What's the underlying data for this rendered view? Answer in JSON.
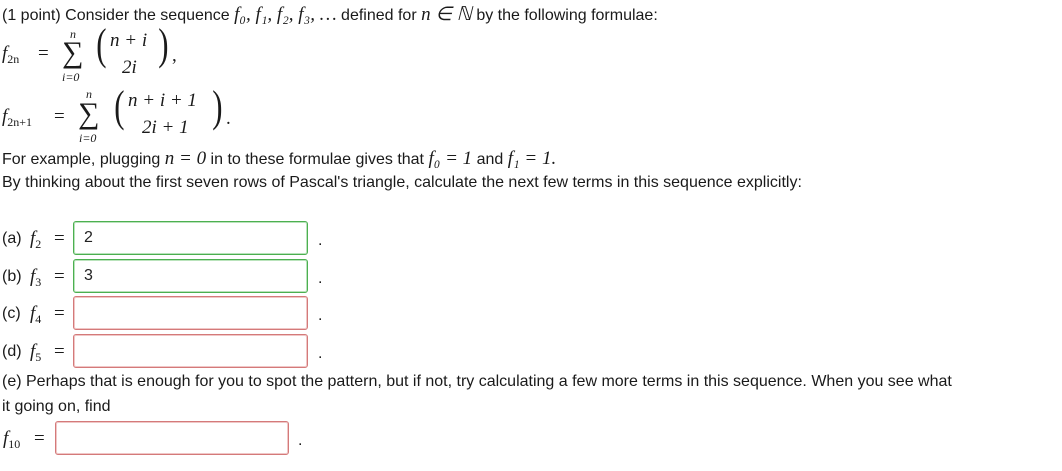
{
  "intro": {
    "points": "(1 point) Consider the sequence",
    "seq": "f₀, f₁, f₂, f₃, …",
    "defined_for": "defined for",
    "n_in_N": "n ∈ ℕ",
    "by_following": "by the following formulae:"
  },
  "formula1": {
    "lhs": "f",
    "lhs_sub": "2n",
    "eq": "=",
    "upper": "n",
    "lower": "i=0",
    "top": "n + i",
    "bottom": "2i",
    "tail": ","
  },
  "formula2": {
    "lhs": "f",
    "lhs_sub": "2n+1",
    "eq": "=",
    "upper": "n",
    "lower": "i=0",
    "top": "n + i + 1",
    "bottom": "2i + 1",
    "tail": "."
  },
  "example": {
    "text1": "For example, plugging",
    "n0": "n = 0",
    "text2": "in to these formulae gives that",
    "f0": "f₀ = 1",
    "and": "and",
    "f1": "f₁ = 1."
  },
  "instruction": "By thinking about the first seven rows of Pascal's triangle, calculate the next few terms in this sequence explicitly:",
  "parts": [
    {
      "label": "(a)",
      "var": "f",
      "sub": "2",
      "value": "2",
      "status": "correct"
    },
    {
      "label": "(b)",
      "var": "f",
      "sub": "3",
      "value": "3",
      "status": "correct"
    },
    {
      "label": "(c)",
      "var": "f",
      "sub": "4",
      "value": "",
      "status": "incorrect"
    },
    {
      "label": "(d)",
      "var": "f",
      "sub": "5",
      "value": "",
      "status": "incorrect"
    }
  ],
  "part_e": {
    "line1": "(e) Perhaps that is enough for you to spot the pattern, but if not, try calculating a few more terms in this sequence. When you see what",
    "line2": "it going on, find",
    "var": "f",
    "sub": "10",
    "value": "",
    "status": "incorrect"
  },
  "eq_sign": "=",
  "period": ".",
  "colors": {
    "correct": "#4caf50",
    "incorrect": "#d47a7a",
    "text": "#1a1a1a"
  }
}
